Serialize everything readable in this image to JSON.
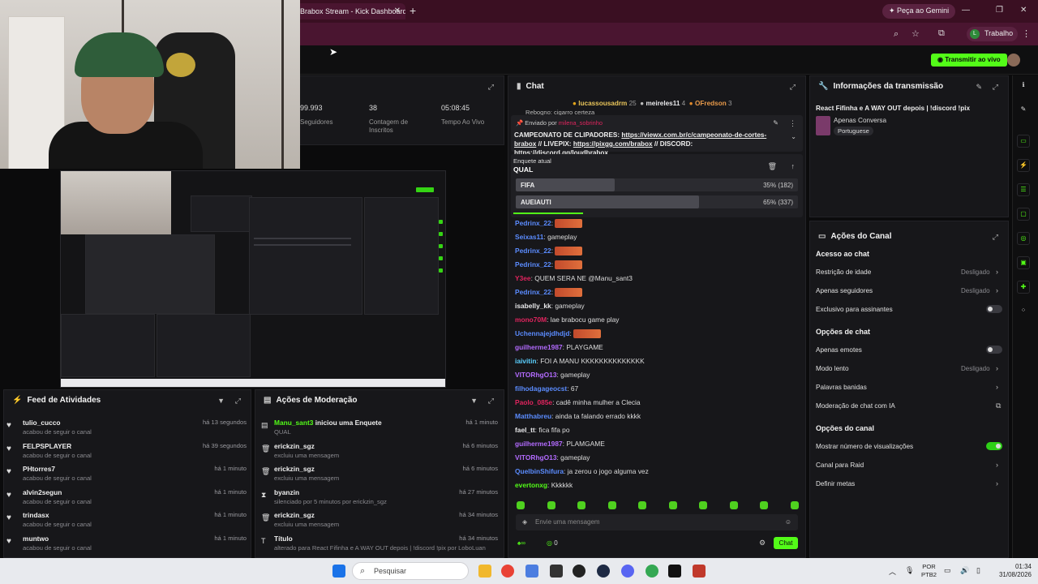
{
  "browser": {
    "tab_title": "Brabox Stream - Kick Dashboard",
    "new_tab": "+",
    "gemini_label": "Peça ao Gemini",
    "profile_label": "Trabalho",
    "profile_initial": "L"
  },
  "kick": {
    "live_button": "Transmitir ao vivo"
  },
  "stats": [
    {
      "value": "99.993",
      "label": "Seguidores"
    },
    {
      "value": "38",
      "label": "Contagem de Inscritos"
    },
    {
      "value": "05:08:45",
      "label": "Tempo Ao Vivo"
    }
  ],
  "chat": {
    "title": "Chat",
    "top_gifters": [
      {
        "name": "lucassousadrm",
        "count": "25"
      },
      {
        "name": "meireles11",
        "count": "4"
      },
      {
        "name": "OFredson",
        "count": "3"
      }
    ],
    "partial_top": "Rebogno: cigarro certeza",
    "pinned": {
      "sent_by_label": "Enviado por",
      "sender": "milena_sobrinho",
      "text1": "CAMPEONATO DE CLIPADORES: ",
      "link1": "https://viewx.com.br/c/campeonato-de-cortes-brabox",
      "text2": " // LIVEPIX: ",
      "link2": "https://pixgg.com/brabox",
      "text3": " // DISCORD: ",
      "link3": "https://discord.gg/loudbrabox"
    },
    "poll": {
      "label": "Enquete atual",
      "question": "QUAL",
      "options": [
        {
          "name": "FIFA",
          "percent": 35,
          "votes": "35% (182)"
        },
        {
          "name": "AUEIAUTI",
          "percent": 65,
          "votes": "65% (337)"
        }
      ]
    },
    "messages": [
      {
        "user": "Pedrinx_22",
        "text": "",
        "color": "#5b8cff",
        "emote": true
      },
      {
        "user": "Seixas11",
        "text": "gameplay",
        "color": "#5b8cff"
      },
      {
        "user": "Pedrinx_22",
        "text": "",
        "color": "#5b8cff",
        "emote": true
      },
      {
        "user": "Pedrinx_22",
        "text": "",
        "color": "#5b8cff",
        "emote": true
      },
      {
        "user": "Y3ee",
        "text": "QUEM SERA NE @Manu_sant3",
        "color": "#e0245e"
      },
      {
        "user": "Pedrinx_22",
        "text": "",
        "color": "#5b8cff",
        "emote": true
      },
      {
        "user": "isabelly_kk",
        "text": "gameplay",
        "color": "#e8e8ea"
      },
      {
        "user": "mono70M",
        "text": "lae brabocu game play",
        "color": "#e0245e"
      },
      {
        "user": "Uchennajejdhdjd",
        "text": "",
        "color": "#5b8cff",
        "emote": true
      },
      {
        "user": "guilherme1987",
        "text": "PLAYGAME",
        "color": "#b36bff"
      },
      {
        "user": "iaivitin",
        "text": "FOI A MANU KKKKKKKKKKKKKK",
        "color": "#5bd0ff"
      },
      {
        "user": "VITORhgO13",
        "text": "gameplay",
        "color": "#b36bff"
      },
      {
        "user": "filhodagageocst",
        "text": "67",
        "color": "#5b8cff"
      },
      {
        "user": "Paolo_085e",
        "text": "cadê minha mulher a Clecia",
        "color": "#e0245e"
      },
      {
        "user": "Matthabreu",
        "text": "ainda ta falando errado kkkk",
        "color": "#5b8cff"
      },
      {
        "user": "fael_tt",
        "text": "fica fifa po",
        "color": "#e8e8ea"
      },
      {
        "user": "guilherme1987",
        "text": "PLAMGAME",
        "color": "#b36bff"
      },
      {
        "user": "VITORhgO13",
        "text": "gameplay",
        "color": "#b36bff"
      },
      {
        "user": "QuelbinShifura",
        "text": "ja zerou o jogo alguma vez",
        "color": "#5b8cff"
      },
      {
        "user": "evertonxg",
        "text": "Kkkkkk",
        "color": "#53fc18"
      }
    ],
    "input_placeholder": "Envie uma mensagem",
    "points": "0",
    "send_button": "Chat"
  },
  "stream_info": {
    "title": "Informações da transmissão",
    "stream_title": "React Fifinha e A WAY OUT depois | !discord !pix",
    "category": "Apenas Conversa",
    "language": "Portuguese"
  },
  "channel_actions": {
    "title": "Ações do Canal",
    "sections": [
      {
        "heading": "Acesso ao chat",
        "rows": [
          {
            "label": "Restrição de idade",
            "value": "Desligado"
          },
          {
            "label": "Apenas seguidores",
            "value": "Desligado"
          },
          {
            "label": "Exclusivo para assinantes",
            "toggle": false
          }
        ]
      },
      {
        "heading": "Opções de chat",
        "rows": [
          {
            "label": "Apenas emotes",
            "toggle": false
          },
          {
            "label": "Modo lento",
            "value": "Desligado"
          },
          {
            "label": "Palavras banidas",
            "value": ""
          },
          {
            "label": "Moderação de chat com IA",
            "value": ""
          }
        ]
      },
      {
        "heading": "Opções do canal",
        "rows": [
          {
            "label": "Mostrar número de visualizações",
            "toggle": true
          },
          {
            "label": "Canal para Raid",
            "value": ""
          },
          {
            "label": "Definir metas",
            "value": ""
          }
        ]
      }
    ]
  },
  "activity_feed": {
    "title": "Feed de Atividades",
    "items": [
      {
        "user": "tulio_cucco",
        "action": "acabou de seguir o canal",
        "time": "há 13 segundos"
      },
      {
        "user": "FELPSPLAYER",
        "action": "acabou de seguir o canal",
        "time": "há 39 segundos"
      },
      {
        "user": "PHtorres7",
        "action": "acabou de seguir o canal",
        "time": "há 1 minuto"
      },
      {
        "user": "alvin2segun",
        "action": "acabou de seguir o canal",
        "time": "há 1 minuto"
      },
      {
        "user": "trindasx",
        "action": "acabou de seguir o canal",
        "time": "há 1 minuto"
      },
      {
        "user": "muntwo",
        "action": "acabou de seguir o canal",
        "time": "há 1 minuto"
      }
    ]
  },
  "moderation": {
    "title": "Ações de Moderação",
    "items": [
      {
        "user": "Manu_sant3",
        "headline_rest": "iniciou uma Enquete",
        "detail": "QUAL",
        "time": "há 1 minuto",
        "icon": "poll-icon"
      },
      {
        "user": "erickzin_sgz",
        "headline_rest": "",
        "detail": "excluiu uma mensagem",
        "time": "há 6 minutos",
        "icon": "trash-icon"
      },
      {
        "user": "erickzin_sgz",
        "headline_rest": "",
        "detail": "excluiu uma mensagem",
        "time": "há 6 minutos",
        "icon": "trash-icon"
      },
      {
        "user": "byanzin",
        "headline_rest": "",
        "detail": "silenciado por 5 minutos por erickzin_sgz",
        "time": "há 27 minutos",
        "icon": "hourglass-icon"
      },
      {
        "user": "erickzin_sgz",
        "headline_rest": "",
        "detail": "excluiu uma mensagem",
        "time": "há 34 minutos",
        "icon": "trash-icon"
      },
      {
        "user": "Título",
        "headline_rest": "",
        "detail": "alterado para React Fifinha e A WAY OUT depois | !discord !pix por LoboLuan",
        "time": "há 34 minutos",
        "icon": "title-icon"
      }
    ]
  },
  "taskbar": {
    "search_placeholder": "Pesquisar",
    "lang": "POR",
    "layout": "PTB2",
    "time": "01:34",
    "date": "31/08/2026"
  }
}
